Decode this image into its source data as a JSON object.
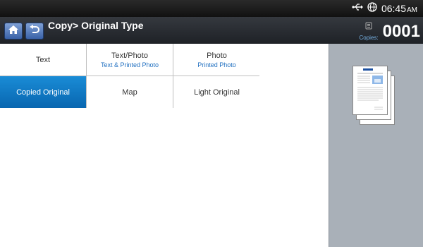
{
  "status_bar": {
    "time": "06:45",
    "ampm": "AM",
    "icons": [
      "usb-icon",
      "globe-icon"
    ]
  },
  "header": {
    "title": "Copy> Original Type",
    "copies_label": "Copies:",
    "copies_count": "0001"
  },
  "options": [
    {
      "label": "Text",
      "sub": "",
      "selected": false
    },
    {
      "label": "Text/Photo",
      "sub": "Text & Printed Photo",
      "selected": false
    },
    {
      "label": "Photo",
      "sub": "Printed Photo",
      "selected": false
    },
    {
      "label": "Copied Original",
      "sub": "",
      "selected": true
    },
    {
      "label": "Map",
      "sub": "",
      "selected": false
    },
    {
      "label": "Light Original",
      "sub": "",
      "selected": false
    }
  ],
  "colors": {
    "selected": "#0a74c4",
    "accent_text": "#1f6fc0",
    "preview_bg": "#a9b0b8"
  }
}
